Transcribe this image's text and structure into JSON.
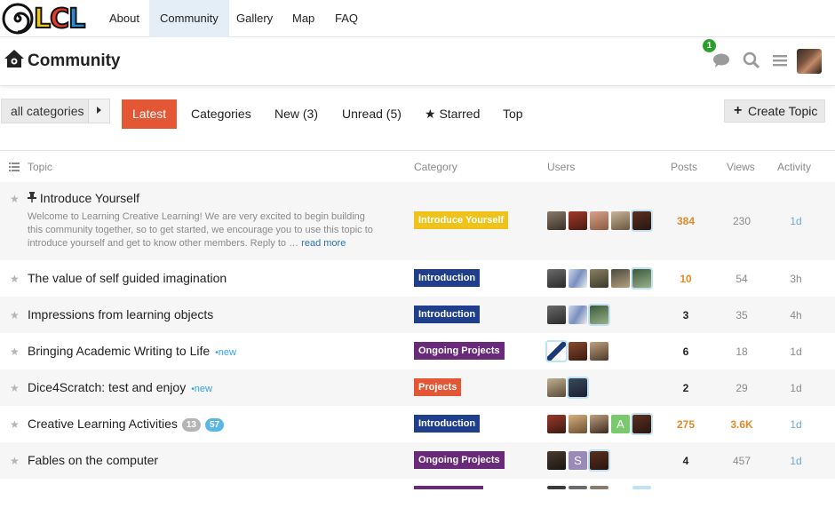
{
  "site_nav": {
    "logo_letters": [
      "L",
      "C",
      "L"
    ],
    "items": [
      "About",
      "Community",
      "Gallery",
      "Map",
      "FAQ"
    ],
    "active": "Community"
  },
  "header": {
    "title": "Community",
    "notification_count": "1"
  },
  "filters": {
    "category_dropdown": "all categories",
    "tabs": [
      "Latest",
      "Categories",
      "New (3)",
      "Unread (5)",
      "Starred",
      "Top"
    ],
    "active_tab": "Latest",
    "create_topic": "Create Topic"
  },
  "columns": {
    "topic": "Topic",
    "category": "Category",
    "users": "Users",
    "posts": "Posts",
    "views": "Views",
    "activity": "Activity"
  },
  "topics": [
    {
      "title": "Introduce Yourself",
      "pinned": true,
      "excerpt": "Welcome to Learning Creative Learning! We are very excited to begin building this community together, so to get started, we encourage you to use this topic to introduce yourself and get to know other members. Reply to …",
      "read_more": "read more",
      "category": "Introduce Yourself",
      "category_color": "#f0c31c",
      "posts": "384",
      "posts_hot": true,
      "views": "230",
      "activity": "1d",
      "activity_color": "#6fa8d0"
    },
    {
      "title": "The value of self guided imagination",
      "category": "Introduction",
      "category_color": "#1f3f8c",
      "posts": "10",
      "posts_hot": true,
      "views": "54",
      "activity": "3h",
      "activity_color": "#8a8a8a"
    },
    {
      "title": "Impressions from learning objects",
      "category": "Introduction",
      "category_color": "#1f3f8c",
      "posts": "3",
      "posts_hot": false,
      "views": "35",
      "activity": "4h",
      "activity_color": "#8a8a8a"
    },
    {
      "title": "Bringing Academic Writing to Life",
      "new_tag": "new",
      "category": "Ongoing Projects",
      "category_color": "#6a2a7a",
      "posts": "6",
      "posts_hot": false,
      "views": "18",
      "activity": "1d",
      "activity_color": "#8a8a8a"
    },
    {
      "title": "Dice4Scratch: test and enjoy",
      "new_tag": "new",
      "category": "Projects",
      "category_color": "#e45735",
      "posts": "2",
      "posts_hot": false,
      "views": "29",
      "activity": "1d",
      "activity_color": "#8a8a8a"
    },
    {
      "title": "Creative Learning Activities",
      "unread_count": "13",
      "new_count": "57",
      "category": "Introduction",
      "category_color": "#1f3f8c",
      "posts": "275",
      "posts_hot": true,
      "views": "3.6K",
      "views_hot": true,
      "activity": "1d",
      "activity_color": "#6fa8d0"
    },
    {
      "title": "Fables on the computer",
      "category": "Ongoing Projects",
      "category_color": "#6a2a7a",
      "posts": "4",
      "posts_hot": false,
      "views": "457",
      "activity": "1d",
      "activity_color": "#6fa8d0"
    }
  ],
  "avatar_letters": {
    "row6": "A",
    "row7": "S"
  },
  "colors": {
    "accent": "#e45735",
    "hot_number": "#e08a2a",
    "link": "#2b72b0"
  }
}
